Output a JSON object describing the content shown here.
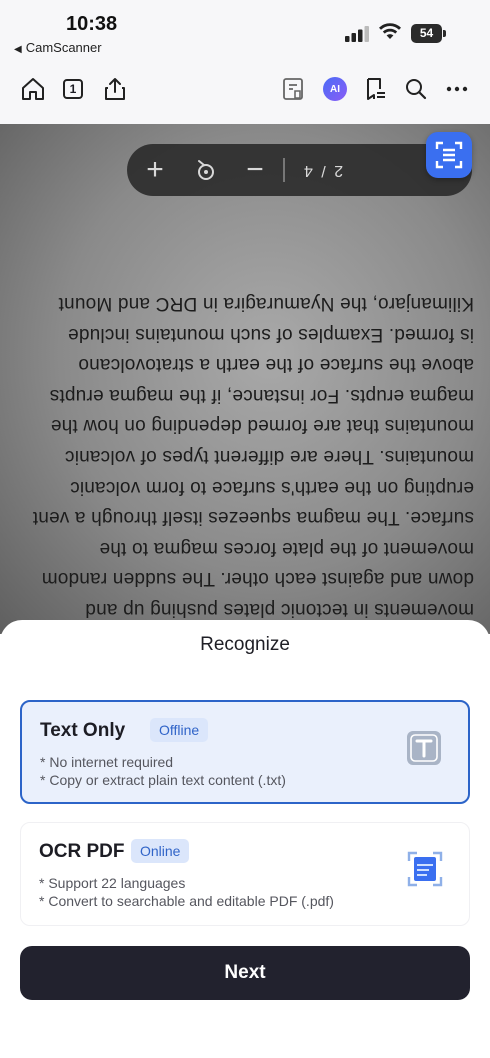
{
  "status_bar": {
    "time": "10:38",
    "back_app": "CamScanner",
    "battery": "54"
  },
  "toolbar": {
    "page_indicator": "1",
    "ai_label": "AI",
    "icons": [
      "home-icon",
      "page-count-icon",
      "share-icon",
      "edit-page-icon",
      "ai-icon",
      "signature-icon",
      "search-icon",
      "more-icon"
    ]
  },
  "document": {
    "lines": [
      "movements in tectonic plates pushing up and",
      "down and against each other. The sudden random",
      "movement of the plate forces magma to the",
      "surface. The magma squeezes itself through a vent",
      "erupting on the earth's surface to form volcanic",
      "mountains. There are different types of volcanic",
      "mountains that are formed depending on how the",
      "magma erupts. For instance, if the magma erupts",
      "above the surface of the earth a stratovolcano",
      "is formed. Examples of such mountains include",
      "Kilimanjaro, the Nyamuragira in DRC and Mount"
    ],
    "page_control": {
      "plus": "+",
      "minus": "−",
      "page_text": "2 / 4"
    }
  },
  "sheet": {
    "title": "Recognize",
    "options": [
      {
        "title": "Text Only",
        "badge": "Offline",
        "desc1": "* No internet required",
        "desc2": "* Copy or extract plain text content (.txt)",
        "selected": true
      },
      {
        "title": "OCR PDF",
        "badge": "Online",
        "desc1": "* Support 22 languages",
        "desc2": "* Convert to searchable and editable PDF (.pdf)",
        "selected": false
      }
    ],
    "next_label": "Next"
  },
  "colors": {
    "accent": "#2c64c8",
    "selected_bg": "#eaf0fc",
    "next_bg": "#22222e",
    "fab": "#3a6ff0"
  }
}
